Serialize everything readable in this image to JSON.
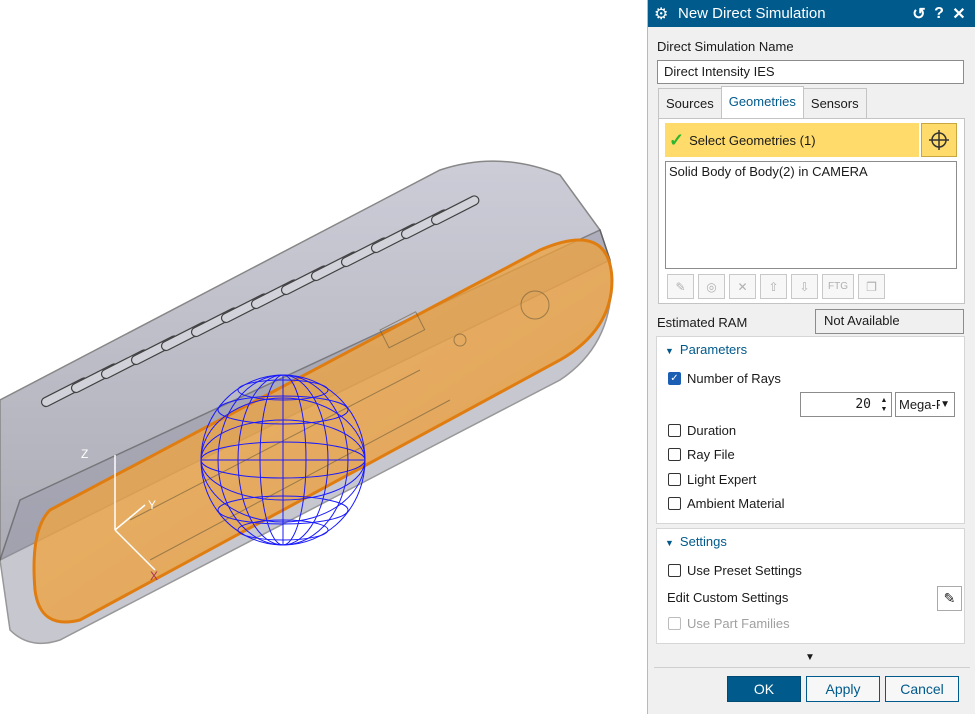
{
  "dialog": {
    "title": "New Direct Simulation",
    "name_label": "Direct Simulation Name",
    "name_value": "Direct Intensity IES",
    "tabs": [
      {
        "label": "Sources"
      },
      {
        "label": "Geometries"
      },
      {
        "label": "Sensors"
      }
    ],
    "geometries": {
      "select_label": "Select Geometries (1)",
      "list_items": [
        "Solid Body of Body(2) in CAMERA"
      ],
      "tool_ftg": "FTG"
    },
    "ram": {
      "label": "Estimated RAM",
      "value": "Not Available"
    },
    "parameters": {
      "header": "Parameters",
      "number_of_rays_label": "Number of Rays",
      "number_of_rays_checked": true,
      "rays_value": "20",
      "rays_unit": "Mega-R",
      "duration_label": "Duration",
      "ray_file_label": "Ray File",
      "light_expert_label": "Light Expert",
      "ambient_material_label": "Ambient Material"
    },
    "settings": {
      "header": "Settings",
      "use_preset_label": "Use Preset Settings",
      "edit_custom_label": "Edit Custom Settings",
      "use_part_families_label": "Use Part Families"
    },
    "buttons": {
      "ok": "OK",
      "apply": "Apply",
      "cancel": "Cancel"
    }
  },
  "viewport": {
    "axis_x": "X",
    "axis_y": "Y",
    "axis_z": "Z"
  },
  "colors": {
    "accent": "#005a8c",
    "selection_bar": "#fedb6b",
    "highlight_face": "#f0a030",
    "sphere_wire": "#1a1aff"
  }
}
